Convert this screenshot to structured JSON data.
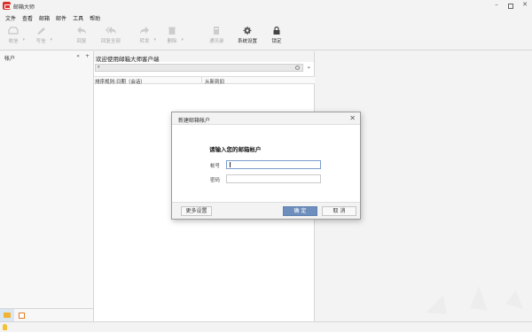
{
  "app": {
    "title": "邮箱大师",
    "window_controls": [
      "minimize",
      "restore",
      "close"
    ]
  },
  "menu": [
    "文件",
    "查看",
    "邮箱",
    "邮件",
    "工具",
    "帮助"
  ],
  "toolbar": {
    "items": [
      {
        "label": "收信",
        "icon": "inbox-icon",
        "enabled": false,
        "dropdown": true
      },
      {
        "label": "写信",
        "icon": "pen-icon",
        "enabled": false,
        "dropdown": true
      },
      {
        "label": "回复",
        "icon": "reply-icon",
        "enabled": false,
        "dropdown": false
      },
      {
        "label": "回复全部",
        "icon": "reply-all-icon",
        "enabled": false,
        "dropdown": false
      },
      {
        "label": "转发",
        "icon": "forward-icon",
        "enabled": false,
        "dropdown": true
      },
      {
        "label": "删除",
        "icon": "trash-icon",
        "enabled": false,
        "dropdown": true
      },
      {
        "label": "通讯录",
        "icon": "contacts-icon",
        "enabled": false,
        "dropdown": false
      },
      {
        "label": "系统设置",
        "icon": "gear-icon",
        "enabled": true,
        "dropdown": false
      },
      {
        "label": "锁定",
        "icon": "lock-icon",
        "enabled": true,
        "dropdown": false
      }
    ]
  },
  "sidebar": {
    "title": "帐户",
    "controls": [
      "«",
      "+"
    ]
  },
  "list_pane": {
    "welcome": "欢迎使用邮箱大师客户端",
    "sort_label": "排序规则:日期（会话）",
    "order_label": "从新到旧"
  },
  "dialog": {
    "title": "新建邮箱帐户",
    "heading": "请输入您的邮箱帐户",
    "account_label": "帐号",
    "account_value": "",
    "password_label": "密码",
    "password_value": "",
    "more_button": "更多设置",
    "ok_button": "确 定",
    "cancel_button": "取 消"
  },
  "colors": {
    "brand": "#d9302c",
    "primary_button": "#6e8fbd",
    "window_bg": "#f3f3f3"
  }
}
